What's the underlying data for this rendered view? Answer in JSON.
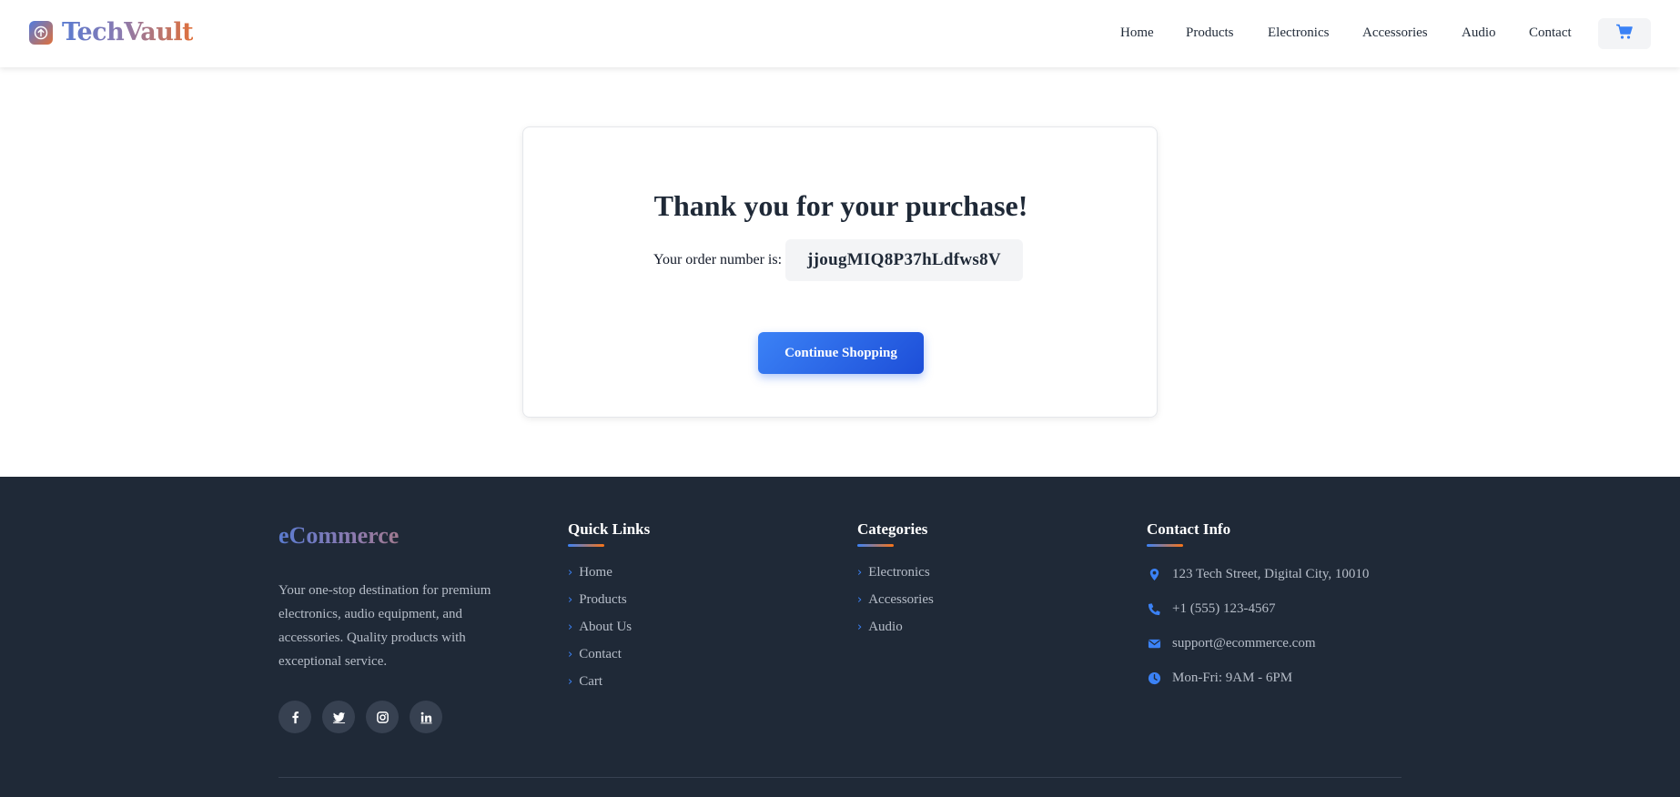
{
  "header": {
    "logo_text": "TechVault",
    "nav": [
      {
        "label": "Home"
      },
      {
        "label": "Products"
      },
      {
        "label": "Electronics"
      },
      {
        "label": "Accessories"
      },
      {
        "label": "Audio"
      },
      {
        "label": "Contact"
      }
    ],
    "cart_icon": "shopping-cart-icon"
  },
  "confirmation": {
    "title": "Thank you for your purchase!",
    "order_label": "Your order number is:",
    "order_number": "jjougMIQ8P37hLdfws8V",
    "continue_label": "Continue Shopping"
  },
  "footer": {
    "brand": "eCommerce",
    "description": "Your one-stop destination for premium electronics, audio equipment, and accessories. Quality products with exceptional service.",
    "socials": [
      "facebook-icon",
      "twitter-icon",
      "instagram-icon",
      "linkedin-icon"
    ],
    "quick_links": {
      "title": "Quick Links",
      "items": [
        "Home",
        "Products",
        "About Us",
        "Contact",
        "Cart"
      ]
    },
    "categories": {
      "title": "Categories",
      "items": [
        "Electronics",
        "Accessories",
        "Audio"
      ]
    },
    "contact": {
      "title": "Contact Info",
      "items": [
        {
          "icon": "map-pin-icon",
          "text": "123 Tech Street, Digital City, 10010"
        },
        {
          "icon": "phone-icon",
          "text": "+1 (555) 123-4567"
        },
        {
          "icon": "envelope-icon",
          "text": "support@ecommerce.com"
        },
        {
          "icon": "clock-icon",
          "text": "Mon-Fri: 9AM - 6PM"
        }
      ]
    }
  },
  "colors": {
    "accent": "#3b82f6",
    "accent_dark": "#1d4ed8",
    "orange": "#f97316",
    "footer_bg": "#1f2937",
    "text_dark": "#1f2937"
  }
}
